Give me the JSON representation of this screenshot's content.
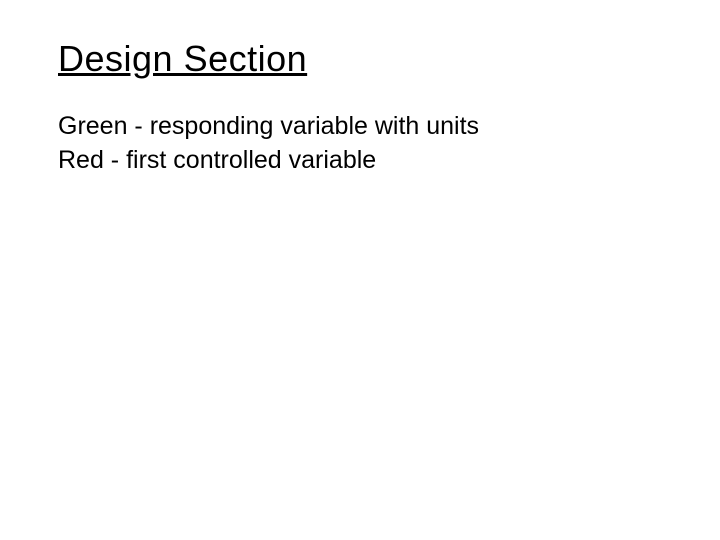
{
  "heading": "Design Section",
  "lines": {
    "line1": "Green - responding variable with units",
    "line2": "Red - first controlled variable"
  }
}
